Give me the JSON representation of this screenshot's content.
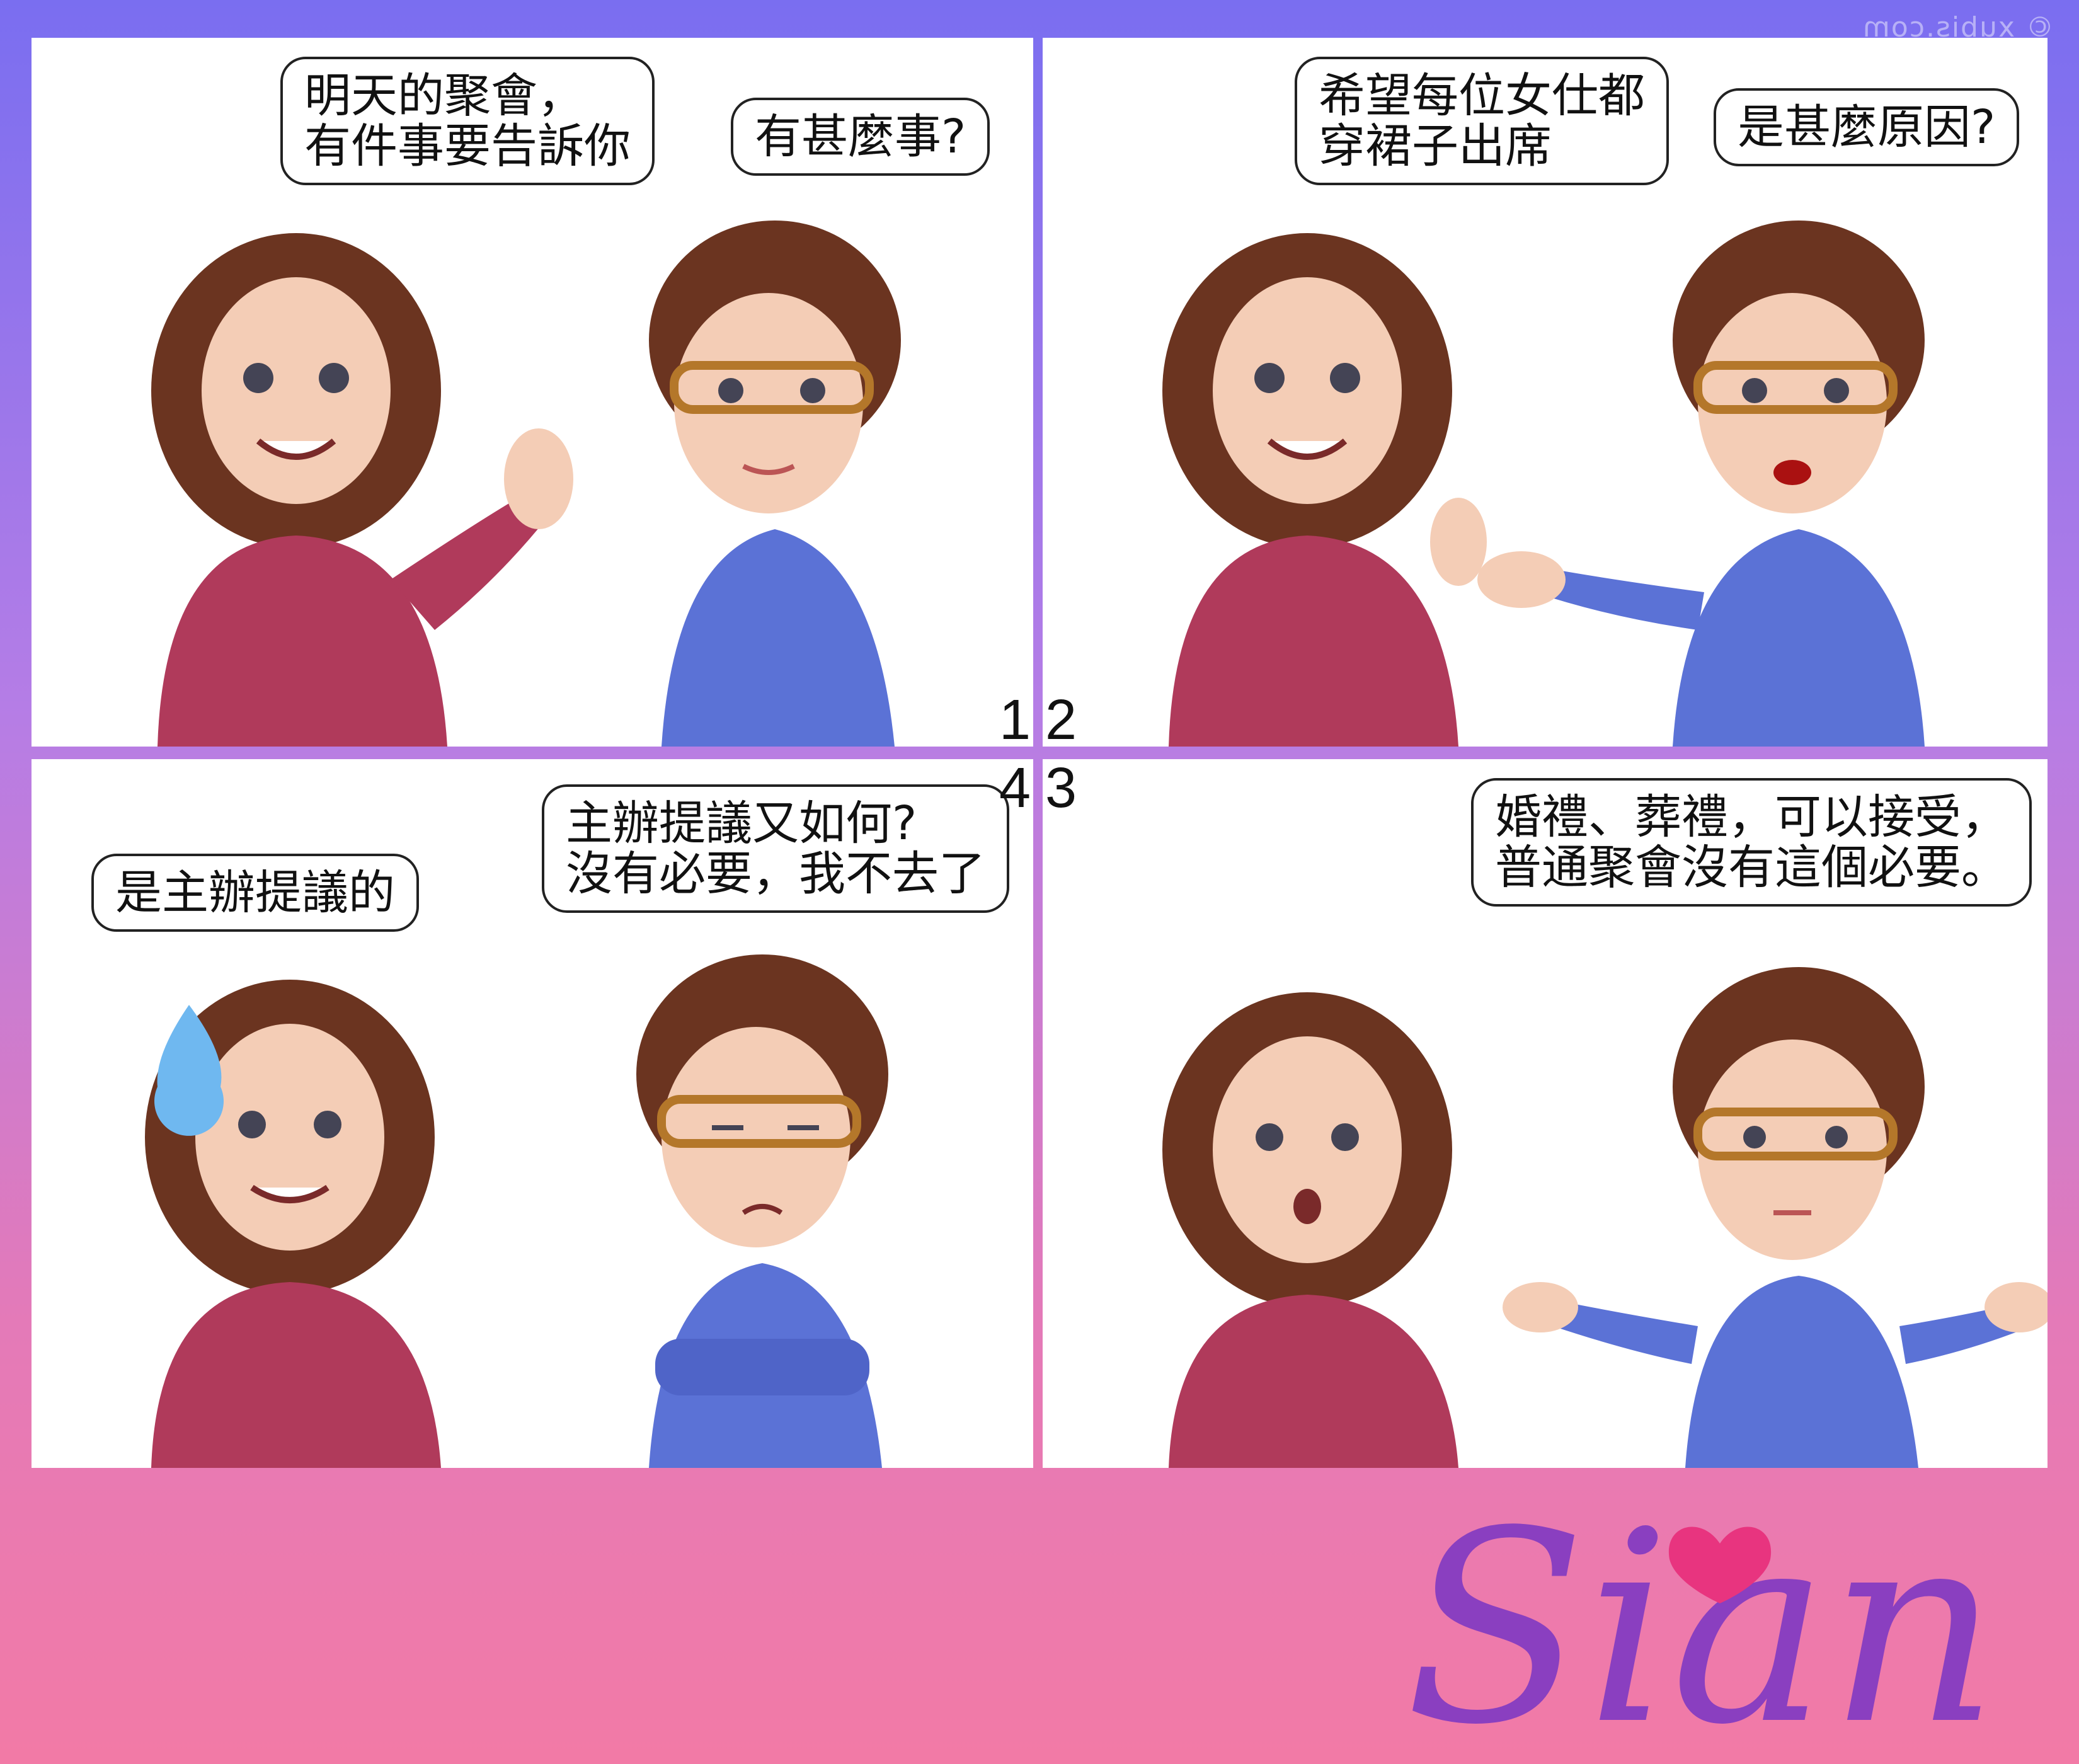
{
  "watermark": "© xubis.com",
  "panels": [
    {
      "num": "1",
      "bubbles": [
        "明天的聚會，\n有件事要告訴你",
        "有甚麼事?"
      ]
    },
    {
      "num": "2",
      "bubbles": [
        "希望每位女仕都\n穿裙子出席",
        "是甚麼原因?"
      ]
    },
    {
      "num": "4",
      "bubbles": [
        "是主辦提議的",
        "主辦提議又如何?\n沒有必要，我不去了"
      ]
    },
    {
      "num": "3",
      "bubbles": [
        "婚禮、葬禮，可以接受，\n普通聚會沒有這個必要。"
      ]
    }
  ],
  "logo": {
    "text": "Sian",
    "icon": "heart-icon"
  },
  "colors": {
    "frame_top": "#7a6ef0",
    "frame_bottom": "#f27aa6",
    "sweater": "#b03a5b",
    "hoodie": "#5b72d6",
    "hair": "#6b3420",
    "logo": "#8a3fc0"
  }
}
